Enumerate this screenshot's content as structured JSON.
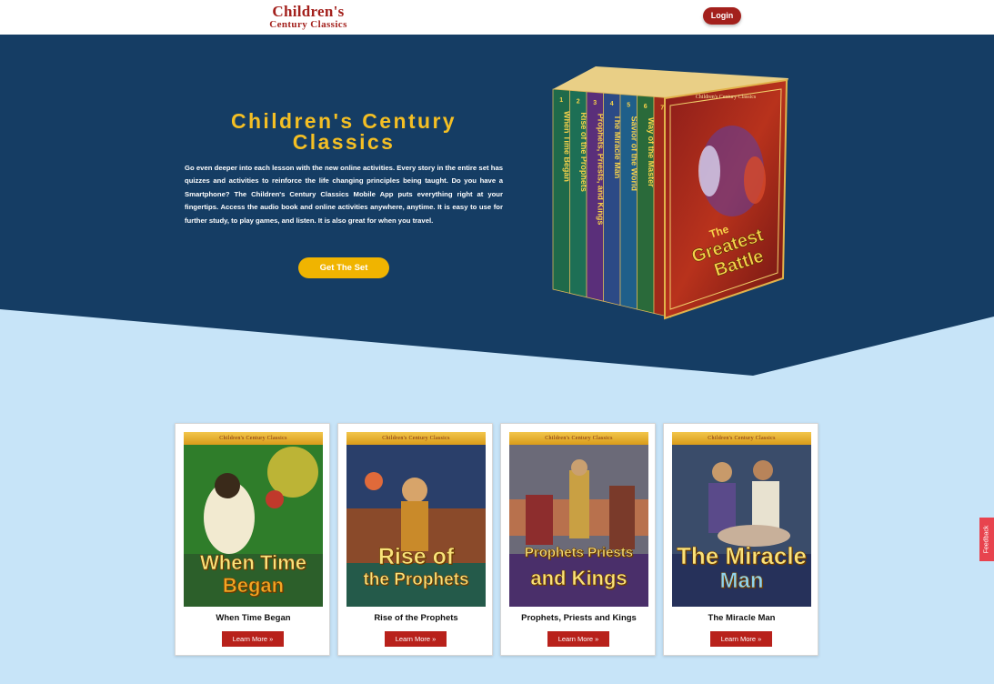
{
  "header": {
    "logo_line1": "Children's",
    "logo_line2": "Century Classics",
    "login_label": "Login"
  },
  "hero": {
    "title": "Children's Century Classics",
    "description": "Go even deeper into each lesson with the new online activities. Every story in the entire set has quizzes and activities to reinforce the life changing principles being taught. Do you have a Smartphone? The Children's Century Classics Mobile App puts everything right at your fingertips. Access the audio book and online activities anywhere, anytime. It is easy to use for further study, to play games, and listen.  It is also great for when you travel.",
    "cta_label": "Get The Set",
    "box_set": {
      "front_title_line1": "The",
      "front_title_line2": "Greatest",
      "front_title_line3": "Battle",
      "front_header": "Children's Century Classics",
      "spines": [
        {
          "number": "1",
          "title": "When Time Began"
        },
        {
          "number": "2",
          "title": "Rise of the Prophets"
        },
        {
          "number": "3",
          "title": "Prophets, Priests, and Kings"
        },
        {
          "number": "4",
          "title": "The Miracle Man"
        },
        {
          "number": "5",
          "title": "Savior of the World"
        },
        {
          "number": "6",
          "title": "Way of the Master"
        },
        {
          "number": "7",
          "title": "The Greatest Battle"
        }
      ]
    }
  },
  "books": [
    {
      "title": "When Time Began",
      "cover_header": "Children's Century Classics",
      "cover_line1": "When Time",
      "cover_line2": "Began",
      "learn_label": "Learn More »"
    },
    {
      "title": "Rise of the Prophets",
      "cover_header": "Children's Century Classics",
      "cover_line1": "Rise of",
      "cover_line2": "the Prophets",
      "learn_label": "Learn More »"
    },
    {
      "title": "Prophets, Priests and Kings",
      "cover_header": "Children's Century Classics",
      "cover_line1": "Prophets Priests",
      "cover_line2": "and Kings",
      "learn_label": "Learn More »"
    },
    {
      "title": "The Miracle Man",
      "cover_header": "Children's Century Classics",
      "cover_line1": "The Miracle",
      "cover_line2": "Man",
      "learn_label": "Learn More »"
    }
  ],
  "feedback_label": "Feedback",
  "colors": {
    "navy": "#153d64",
    "light_blue": "#c7e4f8",
    "gold": "#f4bf24",
    "brand_red": "#a3201c",
    "button_red": "#b8211b",
    "feedback": "#e8434e"
  }
}
